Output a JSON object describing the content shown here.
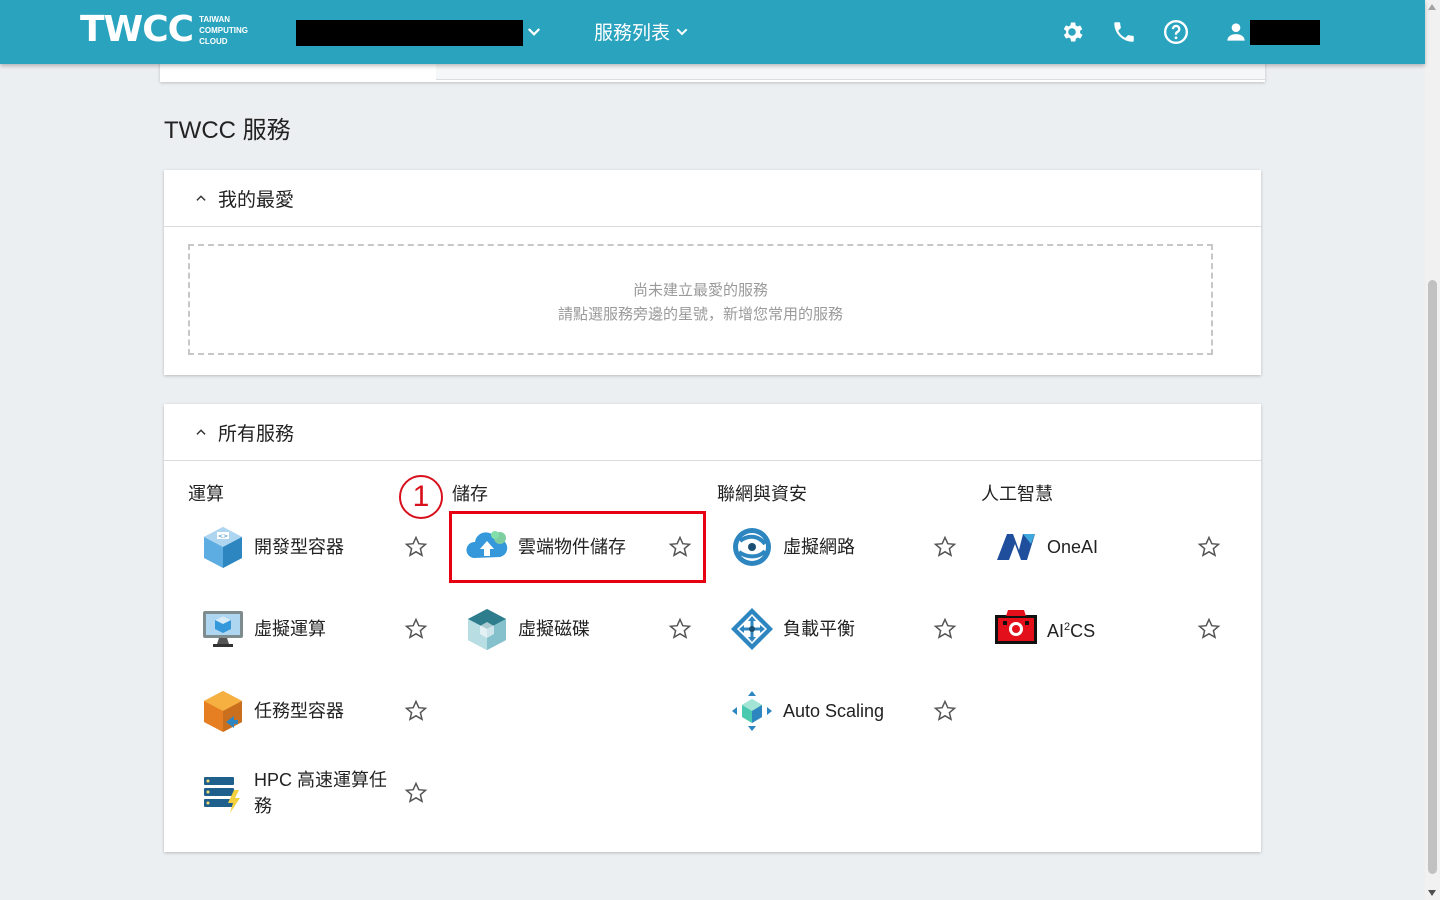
{
  "header": {
    "logo_text": "TWCC",
    "logo_sub_1": "TAIWAN",
    "logo_sub_2": "COMPUTING",
    "logo_sub_3": "CLOUD",
    "service_menu_label": "服務列表"
  },
  "page": {
    "title": "TWCC 服務"
  },
  "favorites": {
    "title": "我的最愛",
    "empty_line1": "尚未建立最愛的服務",
    "empty_line2": "請點選服務旁邊的星號，新增您常用的服務"
  },
  "all_services": {
    "title": "所有服務",
    "columns": [
      {
        "title": "運算",
        "items": [
          {
            "label": "開發型容器",
            "icon": "dev-container-icon"
          },
          {
            "label": "虛擬運算",
            "icon": "virtual-compute-icon"
          },
          {
            "label": "任務型容器",
            "icon": "job-container-icon"
          },
          {
            "label": "HPC 高速運算任務",
            "icon": "hpc-job-icon"
          }
        ]
      },
      {
        "title": "儲存",
        "items": [
          {
            "label": "雲端物件儲存",
            "icon": "cloud-object-storage-icon"
          },
          {
            "label": "虛擬磁碟",
            "icon": "virtual-disk-icon"
          }
        ]
      },
      {
        "title": "聯網與資安",
        "items": [
          {
            "label": "虛擬網路",
            "icon": "virtual-network-icon"
          },
          {
            "label": "負載平衡",
            "icon": "load-balancer-icon"
          },
          {
            "label": "Auto Scaling",
            "icon": "auto-scaling-icon"
          }
        ]
      },
      {
        "title": "人工智慧",
        "items": [
          {
            "label": "OneAI",
            "icon": "oneai-icon"
          },
          {
            "label": "AI",
            "label_sup": "2",
            "label_tail": "CS",
            "icon": "ai2cs-icon"
          }
        ]
      }
    ]
  },
  "annotation": {
    "step_number": "1"
  },
  "colors": {
    "header_bg": "#2aa3bf",
    "highlight": "#e60012"
  }
}
